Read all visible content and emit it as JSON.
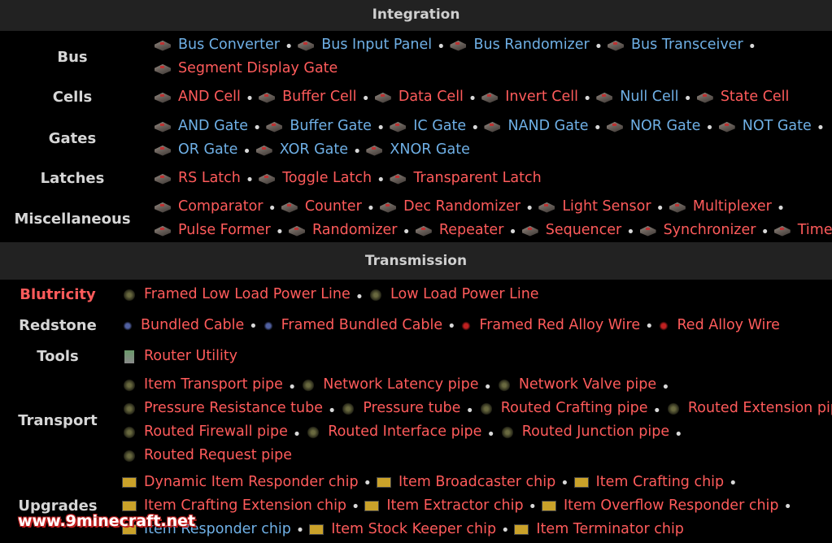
{
  "integration": {
    "header": "Integration",
    "rows": [
      {
        "label": "Bus",
        "lines": [
          [
            {
              "t": "Bus Converter",
              "c": "blue",
              "i": "block"
            },
            {
              "t": "Bus Input Panel",
              "c": "blue",
              "i": "block"
            },
            {
              "t": "Bus Randomizer",
              "c": "blue",
              "i": "block"
            },
            {
              "t": "Bus Transceiver",
              "c": "blue",
              "i": "block"
            }
          ],
          [
            {
              "t": "Segment Display Gate",
              "c": "red",
              "i": "block"
            }
          ]
        ]
      },
      {
        "label": "Cells",
        "lines": [
          [
            {
              "t": "AND Cell",
              "c": "red",
              "i": "block"
            },
            {
              "t": "Buffer Cell",
              "c": "red",
              "i": "block"
            },
            {
              "t": "Data Cell",
              "c": "red",
              "i": "block"
            },
            {
              "t": "Invert Cell",
              "c": "red",
              "i": "block"
            },
            {
              "t": "Null Cell",
              "c": "blue",
              "i": "block"
            },
            {
              "t": "State Cell",
              "c": "red",
              "i": "block"
            }
          ]
        ]
      },
      {
        "label": "Gates",
        "lines": [
          [
            {
              "t": "AND Gate",
              "c": "blue",
              "i": "block"
            },
            {
              "t": "Buffer Gate",
              "c": "blue",
              "i": "block"
            },
            {
              "t": "IC Gate",
              "c": "blue",
              "i": "block"
            },
            {
              "t": "NAND Gate",
              "c": "blue",
              "i": "block"
            },
            {
              "t": "NOR Gate",
              "c": "blue",
              "i": "block"
            },
            {
              "t": "NOT Gate",
              "c": "blue",
              "i": "block"
            }
          ],
          [
            {
              "t": "OR Gate",
              "c": "blue",
              "i": "block"
            },
            {
              "t": "XOR Gate",
              "c": "blue",
              "i": "block"
            },
            {
              "t": "XNOR Gate",
              "c": "blue",
              "i": "block"
            }
          ]
        ]
      },
      {
        "label": "Latches",
        "lines": [
          [
            {
              "t": "RS Latch",
              "c": "red",
              "i": "block"
            },
            {
              "t": "Toggle Latch",
              "c": "red",
              "i": "block"
            },
            {
              "t": "Transparent Latch",
              "c": "red",
              "i": "block"
            }
          ]
        ]
      },
      {
        "label": "Miscellaneous",
        "lines": [
          [
            {
              "t": "Comparator",
              "c": "red",
              "i": "block"
            },
            {
              "t": "Counter",
              "c": "red",
              "i": "block"
            },
            {
              "t": "Dec Randomizer",
              "c": "red",
              "i": "block"
            },
            {
              "t": "Light Sensor",
              "c": "red",
              "i": "block"
            },
            {
              "t": "Multiplexer",
              "c": "red",
              "i": "block"
            }
          ],
          [
            {
              "t": "Pulse Former",
              "c": "red",
              "i": "block"
            },
            {
              "t": "Randomizer",
              "c": "red",
              "i": "block"
            },
            {
              "t": "Repeater",
              "c": "red",
              "i": "block"
            },
            {
              "t": "Sequencer",
              "c": "red",
              "i": "block"
            },
            {
              "t": "Synchronizer",
              "c": "red",
              "i": "block"
            },
            {
              "t": "Timer",
              "c": "red",
              "i": "block"
            }
          ]
        ]
      }
    ]
  },
  "transmission": {
    "header": "Transmission",
    "rows": [
      {
        "label": "Blutricity",
        "label_color": "red",
        "lines": [
          [
            {
              "t": "Framed Low Load Power Line",
              "c": "red",
              "i": "pipe"
            },
            {
              "t": "Low Load Power Line",
              "c": "red",
              "i": "pipe"
            }
          ]
        ]
      },
      {
        "label": "Redstone",
        "lines": [
          [
            {
              "t": "Bundled Cable",
              "c": "red",
              "i": "cable"
            },
            {
              "t": "Framed Bundled Cable",
              "c": "red",
              "i": "cable"
            },
            {
              "t": "Framed Red Alloy Wire",
              "c": "red",
              "i": "wire"
            },
            {
              "t": "Red Alloy Wire",
              "c": "red",
              "i": "wire"
            }
          ]
        ]
      },
      {
        "label": "Tools",
        "lines": [
          [
            {
              "t": "Router Utility",
              "c": "red",
              "i": "tool"
            }
          ]
        ]
      },
      {
        "label": "Transport",
        "lines": [
          [
            {
              "t": "Item Transport pipe",
              "c": "red",
              "i": "pipe"
            },
            {
              "t": "Network Latency pipe",
              "c": "red",
              "i": "pipe"
            },
            {
              "t": "Network Valve pipe",
              "c": "red",
              "i": "pipe"
            }
          ],
          [
            {
              "t": "Pressure Resistance tube",
              "c": "red",
              "i": "pipe"
            },
            {
              "t": "Pressure tube",
              "c": "red",
              "i": "pipe"
            },
            {
              "t": "Routed Crafting pipe",
              "c": "red",
              "i": "pipe"
            },
            {
              "t": "Routed Extension pipe",
              "c": "red",
              "i": "pipe"
            }
          ],
          [
            {
              "t": "Routed Firewall pipe",
              "c": "red",
              "i": "pipe"
            },
            {
              "t": "Routed Interface pipe",
              "c": "red",
              "i": "pipe"
            },
            {
              "t": "Routed Junction pipe",
              "c": "red",
              "i": "pipe"
            }
          ],
          [
            {
              "t": "Routed Request pipe",
              "c": "red",
              "i": "pipe"
            }
          ]
        ]
      },
      {
        "label": "Upgrades",
        "lines": [
          [
            {
              "t": "Dynamic Item Responder chip",
              "c": "red",
              "i": "chip"
            },
            {
              "t": "Item Broadcaster chip",
              "c": "red",
              "i": "chip"
            },
            {
              "t": "Item Crafting chip",
              "c": "red",
              "i": "chip"
            }
          ],
          [
            {
              "t": "Item Crafting Extension chip",
              "c": "red",
              "i": "chip"
            },
            {
              "t": "Item Extractor chip",
              "c": "red",
              "i": "chip"
            },
            {
              "t": "Item Overflow Responder chip",
              "c": "red",
              "i": "chip"
            }
          ],
          [
            {
              "t": "Item Responder chip",
              "c": "blue",
              "i": "chip"
            },
            {
              "t": "Item Stock Keeper chip",
              "c": "red",
              "i": "chip"
            },
            {
              "t": "Item Terminator chip",
              "c": "red",
              "i": "chip"
            }
          ]
        ]
      }
    ]
  },
  "watermark": "www.9minecraft.net",
  "colors": {
    "red": "#ff5b5b",
    "blue": "#6fb0e6",
    "header_bg": "#222222"
  }
}
